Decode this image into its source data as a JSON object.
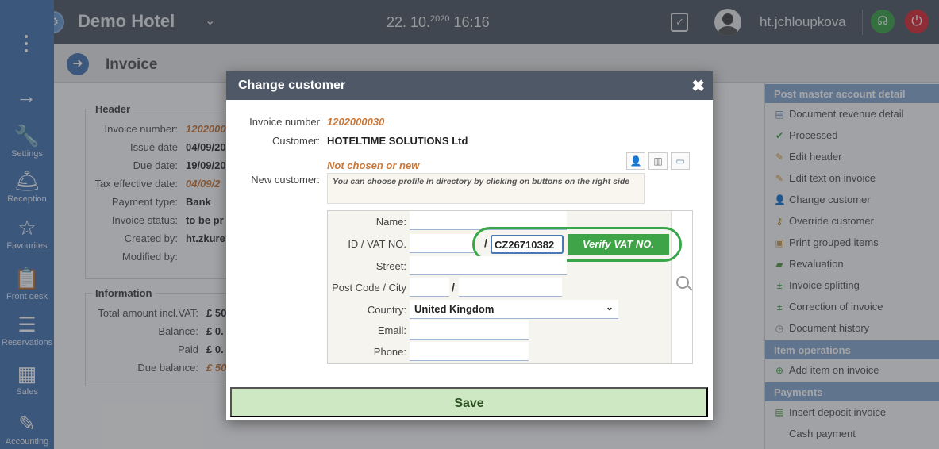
{
  "topbar": {
    "hotel_name": "Demo Hotel",
    "date_main": "22. 10.",
    "date_year": "2020",
    "time": "16:16",
    "username": "ht.jchloupkova"
  },
  "sidebar": {
    "items": [
      {
        "label": "Settings",
        "icon": "wrench-icon"
      },
      {
        "label": "Reception",
        "icon": "bell-icon"
      },
      {
        "label": "Favourites",
        "icon": "star-icon"
      },
      {
        "label": "Front desk",
        "icon": "clipboard-icon"
      },
      {
        "label": "Reservations",
        "icon": "sliders-icon"
      },
      {
        "label": "Sales",
        "icon": "calculator-icon"
      },
      {
        "label": "Accounting",
        "icon": "pen-icon"
      }
    ]
  },
  "page": {
    "title": "Invoice"
  },
  "header_section": {
    "legend": "Header",
    "rows": [
      {
        "label": "Invoice number:",
        "value": "1202000"
      },
      {
        "label": "Issue date",
        "value": "04/09/20"
      },
      {
        "label": "Due date:",
        "value": "19/09/20"
      },
      {
        "label": "Tax effective date:",
        "value": "04/09/2"
      },
      {
        "label": "Payment type:",
        "value": "Bank"
      },
      {
        "label": "Invoice status:",
        "value": "to be pr"
      },
      {
        "label": "Created by:",
        "value": "ht.zkure"
      },
      {
        "label": "Modified by:",
        "value": ""
      }
    ]
  },
  "info_section": {
    "legend": "Information",
    "rows": [
      {
        "label": "Total amount incl.VAT:",
        "value": "£ 50"
      },
      {
        "label": "Balance:",
        "value": "£ 0."
      },
      {
        "label": "Paid",
        "value": "£ 0."
      },
      {
        "label": "Due balance:",
        "value": "£ 50"
      }
    ]
  },
  "rightpanel": {
    "section1": "Post master account detail",
    "items1": [
      {
        "label": "Document revenue detail",
        "icon": "table-icon"
      },
      {
        "label": "Processed",
        "icon": "check-icon"
      },
      {
        "label": "Edit header",
        "icon": "pencil-icon"
      },
      {
        "label": "Edit text on invoice",
        "icon": "pencil-icon"
      },
      {
        "label": "Change customer",
        "icon": "person-icon"
      },
      {
        "label": "Override customer",
        "icon": "key-icon"
      },
      {
        "label": "Print grouped items",
        "icon": "box-icon"
      },
      {
        "label": "Revaluation",
        "icon": "money-icon"
      },
      {
        "label": "Invoice splitting",
        "icon": "plus-minus-icon"
      },
      {
        "label": "Correction of invoice",
        "icon": "plus-minus-icon"
      },
      {
        "label": "Document history",
        "icon": "clock-icon"
      }
    ],
    "section2": "Item operations",
    "items2": [
      {
        "label": "Add item on invoice",
        "icon": "add-circle-icon"
      }
    ],
    "section3": "Payments",
    "items3": [
      {
        "label": "Insert deposit invoice",
        "icon": "document-icon"
      },
      {
        "label": "Cash payment",
        "icon": ""
      }
    ]
  },
  "modal": {
    "title": "Change customer",
    "invoice_number_label": "Invoice number",
    "invoice_number": "1202000030",
    "customer_label": "Customer:",
    "customer": "HOTELTIME SOLUTIONS Ltd",
    "new_customer_label": "New customer:",
    "new_customer_value": "Not chosen or new",
    "hint": "You can choose profile in directory by clicking on buttons on the right side",
    "form": {
      "name_label": "Name:",
      "name_value": "",
      "vat_label": "ID / VAT NO.",
      "id_value": "",
      "vat_value": "CZ26710382",
      "verify_label": "Verify VAT NO.",
      "street_label": "Street:",
      "street_value": "",
      "postcode_label": "Post Code / City",
      "postcode_value": "",
      "city_value": "",
      "country_label": "Country:",
      "country_value": "United Kingdom",
      "email_label": "Email:",
      "email_value": "",
      "phone_label": "Phone:",
      "phone_value": ""
    },
    "save_label": "Save"
  },
  "colors": {
    "topbar": "#545c66",
    "sidebar": "#4a78b2",
    "accent_green": "#3fa447",
    "orange_value": "#c8783a",
    "save_bg": "#cfe8c4"
  }
}
